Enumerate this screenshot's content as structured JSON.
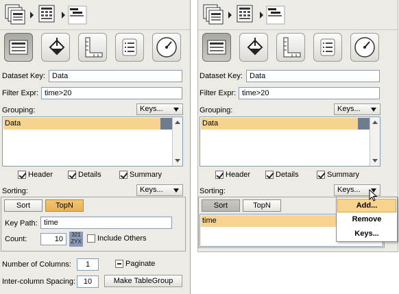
{
  "left": {
    "dataset_key_label": "Dataset Key:",
    "dataset_key_value": "Data",
    "filter_label": "Filter Expr:",
    "filter_value": "time>20",
    "grouping_label": "Grouping:",
    "keys_label": "Keys...",
    "grouping_items": [
      "Data"
    ],
    "header_label": "Header",
    "details_label": "Details",
    "summary_label": "Summary",
    "sorting_label": "Sorting:",
    "sort_tab": "Sort",
    "topn_tab": "TopN",
    "key_path_label": "Key Path:",
    "key_path_value": "time",
    "count_label": "Count:",
    "count_value": "10",
    "sort_icon_top": "321",
    "sort_icon_bottom": "ZYX",
    "include_others_label": "Include Others",
    "columns_label": "Number of Columns:",
    "columns_value": "1",
    "paginate_label": "Paginate",
    "spacing_label": "Inter-column Spacing:",
    "spacing_value": "10",
    "make_button": "Make TableGroup"
  },
  "right": {
    "dataset_key_label": "Dataset Key:",
    "dataset_key_value": "Data",
    "filter_label": "Filter Expr:",
    "filter_value": "time>20",
    "grouping_label": "Grouping:",
    "keys_label": "Keys...",
    "grouping_items": [
      "Data"
    ],
    "header_label": "Header",
    "details_label": "Details",
    "summary_label": "Summary",
    "sorting_label": "Sorting:",
    "sort_tab": "Sort",
    "topn_tab": "TopN",
    "sort_items": [
      "time"
    ],
    "menu": [
      "Add...",
      "Remove",
      "Keys..."
    ]
  }
}
